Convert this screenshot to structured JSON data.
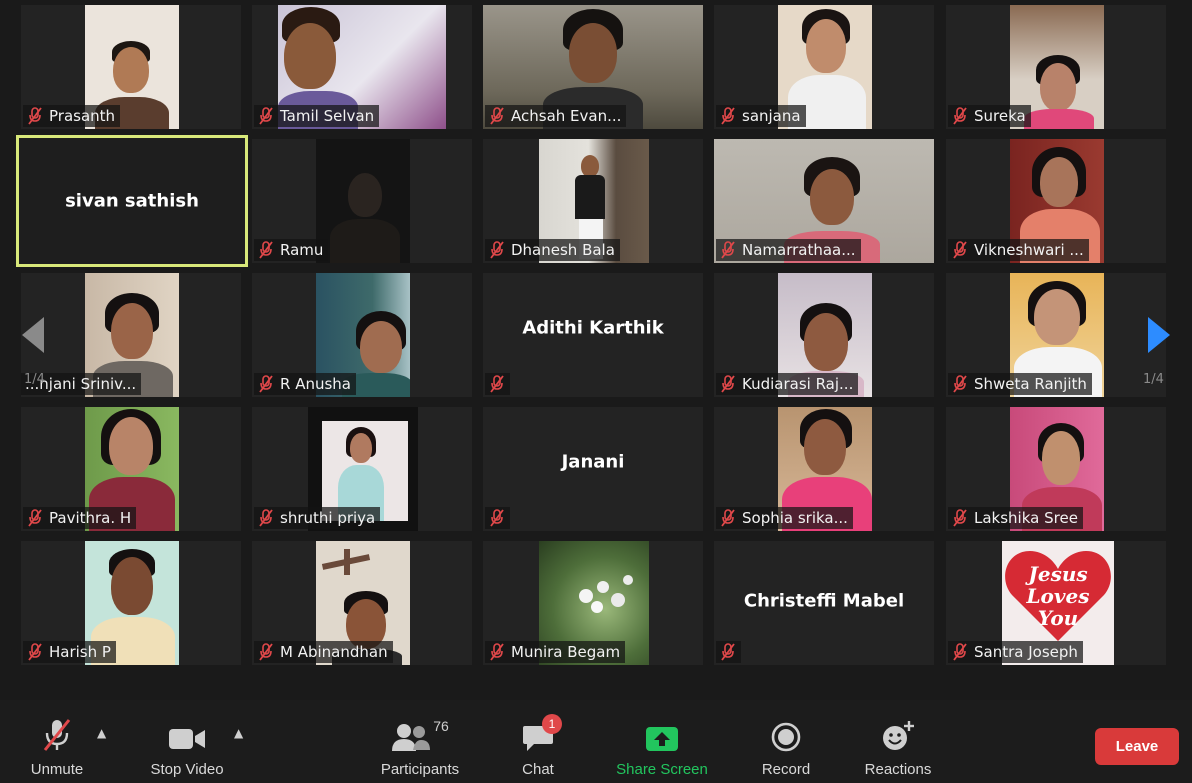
{
  "gallery": {
    "page_indicator_left": "1/4",
    "page_indicator_right": "1/4",
    "tiles": [
      {
        "name": "Prasanth",
        "muted": true,
        "video": true,
        "bg": "#e9e2da"
      },
      {
        "name": "Tamil Selvan",
        "muted": true,
        "video": true,
        "bg": "#7c6aa8"
      },
      {
        "name": "Achsah Evan...",
        "muted": true,
        "video": true,
        "bg": "#6b6658"
      },
      {
        "name": "sanjana",
        "muted": true,
        "video": true,
        "bg": "#e8dccf"
      },
      {
        "name": "Sureka",
        "muted": true,
        "video": true,
        "bg": "#cfc5b8"
      },
      {
        "name": "sivan sathish",
        "muted": false,
        "video": false,
        "active": true
      },
      {
        "name": "Ramu",
        "muted": true,
        "video": true,
        "bg": "#151515"
      },
      {
        "name": "Dhanesh Bala",
        "muted": true,
        "video": true,
        "bg": "#8a8c88"
      },
      {
        "name": "Namarrathaa...",
        "muted": true,
        "video": true,
        "bg": "#b9b5ad"
      },
      {
        "name": "Vikneshwari ...",
        "muted": true,
        "video": true,
        "bg": "#7a2f2a"
      },
      {
        "name": "...njani Sriniv...",
        "muted": false,
        "video": true,
        "bg": "#b8a99a"
      },
      {
        "name": "R Anusha",
        "muted": true,
        "video": true,
        "bg": "#2c5560"
      },
      {
        "name": "Adithi Karthik",
        "muted": true,
        "video": false
      },
      {
        "name": "Kudiarasi Raj...",
        "muted": true,
        "video": true,
        "bg": "#d9cfc9"
      },
      {
        "name": "Shweta Ranjith",
        "muted": true,
        "video": true,
        "bg": "#e2b05a"
      },
      {
        "name": "Pavithra. H",
        "muted": true,
        "video": true,
        "bg": "#7fa45a"
      },
      {
        "name": "shruthi priya",
        "muted": true,
        "video": true,
        "bg": "#e6e0e0"
      },
      {
        "name": "Janani",
        "muted": true,
        "video": false
      },
      {
        "name": "Sophia srika...",
        "muted": true,
        "video": true,
        "bg": "#c7a37e"
      },
      {
        "name": "Lakshika Sree",
        "muted": true,
        "video": true,
        "bg": "#d45d8c"
      },
      {
        "name": "Harish P",
        "muted": true,
        "video": true,
        "bg": "#bfe0d6"
      },
      {
        "name": "M Abinandhan",
        "muted": true,
        "video": true,
        "bg": "#d8d0c4"
      },
      {
        "name": "Munira Begam",
        "muted": true,
        "video": true,
        "bg": "#4f6e3a"
      },
      {
        "name": "Christeffi Mabel",
        "muted": true,
        "video": false
      },
      {
        "name": "Santra Joseph",
        "muted": true,
        "video": true,
        "bg": "#f3ecec",
        "picture_text": "Jesus Loves You"
      }
    ]
  },
  "toolbar": {
    "unmute": "Unmute",
    "stop_video": "Stop Video",
    "participants": "Participants",
    "participants_count": "76",
    "chat": "Chat",
    "chat_badge": "1",
    "share_screen": "Share Screen",
    "record": "Record",
    "reactions": "Reactions",
    "leave": "Leave"
  },
  "colors": {
    "active_outline": "#d8e87a",
    "muted_icon": "#e0484a",
    "share_green": "#22c55e",
    "nav_active": "#2d8cff",
    "leave_red": "#d93a3a"
  }
}
